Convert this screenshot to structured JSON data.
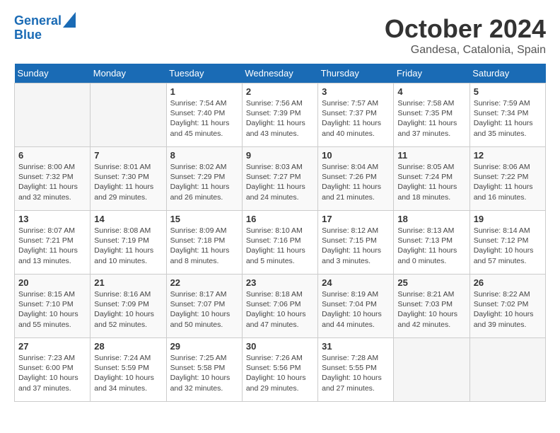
{
  "header": {
    "logo_line1": "General",
    "logo_line2": "Blue",
    "month": "October 2024",
    "location": "Gandesa, Catalonia, Spain"
  },
  "weekdays": [
    "Sunday",
    "Monday",
    "Tuesday",
    "Wednesday",
    "Thursday",
    "Friday",
    "Saturday"
  ],
  "weeks": [
    [
      {
        "day": "",
        "info": ""
      },
      {
        "day": "",
        "info": ""
      },
      {
        "day": "1",
        "info": "Sunrise: 7:54 AM\nSunset: 7:40 PM\nDaylight: 11 hours and 45 minutes."
      },
      {
        "day": "2",
        "info": "Sunrise: 7:56 AM\nSunset: 7:39 PM\nDaylight: 11 hours and 43 minutes."
      },
      {
        "day": "3",
        "info": "Sunrise: 7:57 AM\nSunset: 7:37 PM\nDaylight: 11 hours and 40 minutes."
      },
      {
        "day": "4",
        "info": "Sunrise: 7:58 AM\nSunset: 7:35 PM\nDaylight: 11 hours and 37 minutes."
      },
      {
        "day": "5",
        "info": "Sunrise: 7:59 AM\nSunset: 7:34 PM\nDaylight: 11 hours and 35 minutes."
      }
    ],
    [
      {
        "day": "6",
        "info": "Sunrise: 8:00 AM\nSunset: 7:32 PM\nDaylight: 11 hours and 32 minutes."
      },
      {
        "day": "7",
        "info": "Sunrise: 8:01 AM\nSunset: 7:30 PM\nDaylight: 11 hours and 29 minutes."
      },
      {
        "day": "8",
        "info": "Sunrise: 8:02 AM\nSunset: 7:29 PM\nDaylight: 11 hours and 26 minutes."
      },
      {
        "day": "9",
        "info": "Sunrise: 8:03 AM\nSunset: 7:27 PM\nDaylight: 11 hours and 24 minutes."
      },
      {
        "day": "10",
        "info": "Sunrise: 8:04 AM\nSunset: 7:26 PM\nDaylight: 11 hours and 21 minutes."
      },
      {
        "day": "11",
        "info": "Sunrise: 8:05 AM\nSunset: 7:24 PM\nDaylight: 11 hours and 18 minutes."
      },
      {
        "day": "12",
        "info": "Sunrise: 8:06 AM\nSunset: 7:22 PM\nDaylight: 11 hours and 16 minutes."
      }
    ],
    [
      {
        "day": "13",
        "info": "Sunrise: 8:07 AM\nSunset: 7:21 PM\nDaylight: 11 hours and 13 minutes."
      },
      {
        "day": "14",
        "info": "Sunrise: 8:08 AM\nSunset: 7:19 PM\nDaylight: 11 hours and 10 minutes."
      },
      {
        "day": "15",
        "info": "Sunrise: 8:09 AM\nSunset: 7:18 PM\nDaylight: 11 hours and 8 minutes."
      },
      {
        "day": "16",
        "info": "Sunrise: 8:10 AM\nSunset: 7:16 PM\nDaylight: 11 hours and 5 minutes."
      },
      {
        "day": "17",
        "info": "Sunrise: 8:12 AM\nSunset: 7:15 PM\nDaylight: 11 hours and 3 minutes."
      },
      {
        "day": "18",
        "info": "Sunrise: 8:13 AM\nSunset: 7:13 PM\nDaylight: 11 hours and 0 minutes."
      },
      {
        "day": "19",
        "info": "Sunrise: 8:14 AM\nSunset: 7:12 PM\nDaylight: 10 hours and 57 minutes."
      }
    ],
    [
      {
        "day": "20",
        "info": "Sunrise: 8:15 AM\nSunset: 7:10 PM\nDaylight: 10 hours and 55 minutes."
      },
      {
        "day": "21",
        "info": "Sunrise: 8:16 AM\nSunset: 7:09 PM\nDaylight: 10 hours and 52 minutes."
      },
      {
        "day": "22",
        "info": "Sunrise: 8:17 AM\nSunset: 7:07 PM\nDaylight: 10 hours and 50 minutes."
      },
      {
        "day": "23",
        "info": "Sunrise: 8:18 AM\nSunset: 7:06 PM\nDaylight: 10 hours and 47 minutes."
      },
      {
        "day": "24",
        "info": "Sunrise: 8:19 AM\nSunset: 7:04 PM\nDaylight: 10 hours and 44 minutes."
      },
      {
        "day": "25",
        "info": "Sunrise: 8:21 AM\nSunset: 7:03 PM\nDaylight: 10 hours and 42 minutes."
      },
      {
        "day": "26",
        "info": "Sunrise: 8:22 AM\nSunset: 7:02 PM\nDaylight: 10 hours and 39 minutes."
      }
    ],
    [
      {
        "day": "27",
        "info": "Sunrise: 7:23 AM\nSunset: 6:00 PM\nDaylight: 10 hours and 37 minutes."
      },
      {
        "day": "28",
        "info": "Sunrise: 7:24 AM\nSunset: 5:59 PM\nDaylight: 10 hours and 34 minutes."
      },
      {
        "day": "29",
        "info": "Sunrise: 7:25 AM\nSunset: 5:58 PM\nDaylight: 10 hours and 32 minutes."
      },
      {
        "day": "30",
        "info": "Sunrise: 7:26 AM\nSunset: 5:56 PM\nDaylight: 10 hours and 29 minutes."
      },
      {
        "day": "31",
        "info": "Sunrise: 7:28 AM\nSunset: 5:55 PM\nDaylight: 10 hours and 27 minutes."
      },
      {
        "day": "",
        "info": ""
      },
      {
        "day": "",
        "info": ""
      }
    ]
  ]
}
